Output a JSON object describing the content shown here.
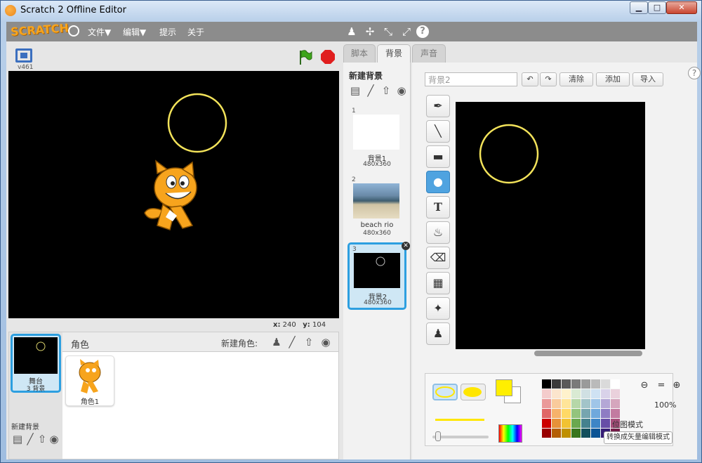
{
  "window": {
    "title": "Scratch 2 Offline Editor",
    "min_label": "▁",
    "max_label": "□",
    "close_label": "✕"
  },
  "menubar": {
    "logo": "SCRATCH",
    "items": [
      "文件▼",
      "编辑▼",
      "提示",
      "关于"
    ]
  },
  "stage": {
    "version": "v461",
    "coord_x_label": "x:",
    "coord_x": "240",
    "coord_y_label": "y:",
    "coord_y": "104"
  },
  "sprites": {
    "title": "角色",
    "new_sprite_label": "新建角色:",
    "stage_thumb_name": "舞台",
    "stage_thumb_count": "3 背景",
    "new_backdrop_small": "新建背景",
    "sprite1_name": "角色1"
  },
  "tabs": [
    "脚本",
    "背景",
    "声音"
  ],
  "backdrops": {
    "title": "新建背景",
    "items": [
      {
        "num": "1",
        "name": "背景1",
        "size": "480x360"
      },
      {
        "num": "2",
        "name": "beach rio",
        "size": "480x360"
      },
      {
        "num": "3",
        "name": "背景2",
        "size": "480x360"
      }
    ]
  },
  "paint": {
    "costume_name": "背景2",
    "clear_label": "清除",
    "add_label": "添加",
    "import_label": "导入",
    "zoom_level": "100%",
    "mode_label": "位图模式",
    "convert_label": "转换成矢量编辑模式"
  },
  "colors": {
    "accent": "#2d9fe0",
    "stage_bg": "#000000",
    "circle_stroke": "#f3e35a",
    "fill_color": "#ffef00"
  }
}
